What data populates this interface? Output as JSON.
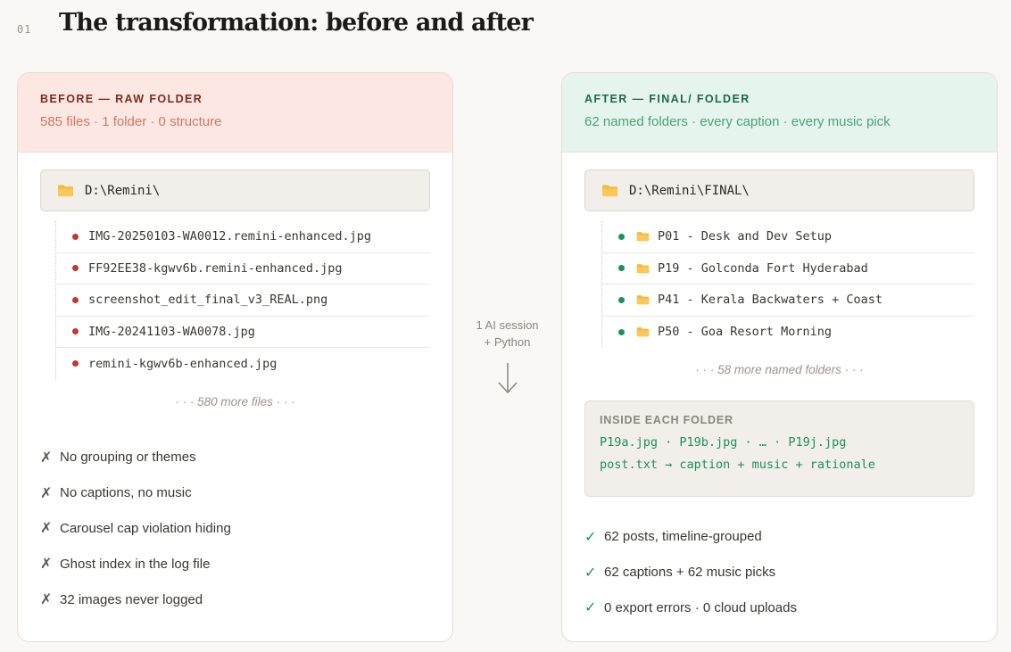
{
  "section": {
    "number": "01",
    "title": "The transformation: before and after"
  },
  "before": {
    "label": "BEFORE — RAW FOLDER",
    "subtitle": "585 files · 1 folder · 0 structure",
    "path": "D:\\Remini\\",
    "files": [
      "IMG-20250103-WA0012.remini-enhanced.jpg",
      "FF92EE38-kgwv6b.remini-enhanced.jpg",
      "screenshot_edit_final_v3_REAL.png",
      "IMG-20241103-WA0078.jpg",
      "remini-kgwv6b-enhanced.jpg"
    ],
    "more": "· · · 580 more files · · ·",
    "problems": [
      "No grouping or themes",
      "No captions, no music",
      "Carousel cap violation hiding",
      "Ghost index in the log file",
      "32 images never logged"
    ],
    "mark": "✗"
  },
  "middle": {
    "line1": "1 AI session",
    "line2": "+ Python"
  },
  "after": {
    "label": "AFTER — FINAL/ FOLDER",
    "subtitle": "62 named folders · every caption · every music pick",
    "path": "D:\\Remini\\FINAL\\",
    "folders": [
      "P01 - Desk and Dev Setup",
      "P19 - Golconda Fort Hyderabad",
      "P41 - Kerala Backwaters + Coast",
      "P50 - Goa Resort Morning"
    ],
    "more": "· · · 58 more named folders · · ·",
    "inside": {
      "label": "INSIDE EACH FOLDER",
      "line1": "P19a.jpg · P19b.jpg · … · P19j.jpg",
      "line2": "post.txt → caption + music + rationale"
    },
    "results": [
      "62 posts, timeline-grouped",
      "62 captions + 62 music picks",
      "0 export errors · 0 cloud uploads"
    ],
    "mark": "✓"
  },
  "colors": {
    "before_accent": "#c0392b",
    "after_accent": "#1d8f5b",
    "folder_icon": "#f5b93b"
  }
}
